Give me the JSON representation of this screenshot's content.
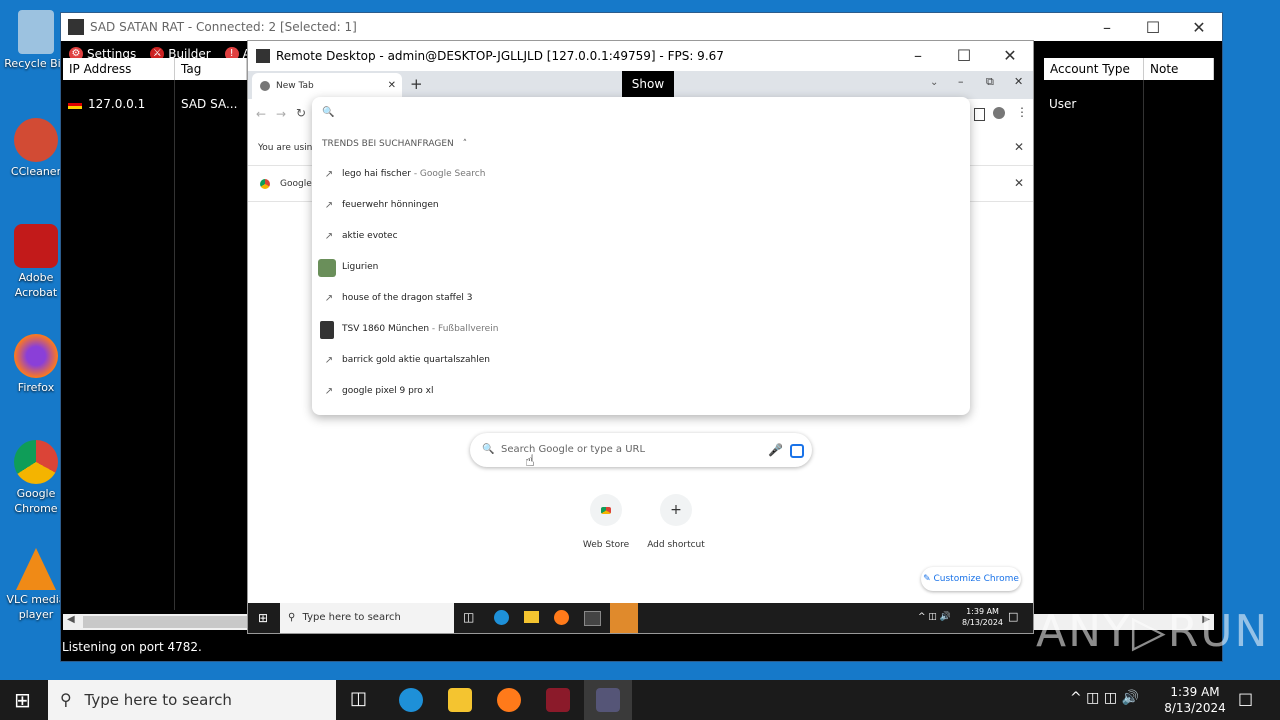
{
  "desktop": {
    "icons": [
      {
        "label": "Recycle Bin",
        "color": "#7fb0d8"
      },
      {
        "label": "CCleaner",
        "color": "#d24b34"
      },
      {
        "label": "Adobe Acrobat",
        "color": "#c21a1a"
      },
      {
        "label": "Firefox",
        "color": "#ff7a1a"
      },
      {
        "label": "Google Chrome",
        "color": "#2f8fe6"
      },
      {
        "label": "VLC media player",
        "color": "#f08a16"
      }
    ]
  },
  "rat": {
    "title": "SAD SATAN RAT - Connected: 2 [Selected: 1]",
    "menu": {
      "settings": "Settings",
      "builder": "Builder",
      "about": "A"
    },
    "columns": {
      "ip": "IP Address",
      "tag": "Tag",
      "account_type": "Account Type",
      "note": "Note"
    },
    "row": {
      "ip": "127.0.0.1",
      "tag": "SAD SA...",
      "account_type": "User"
    },
    "status": "Listening on port 4782."
  },
  "remote_desktop": {
    "title": "Remote Desktop - admin@DESKTOP-JGLLJLD [127.0.0.1:49759] - FPS: 9.67",
    "show_button": "Show",
    "chrome": {
      "tab_title": "New Tab",
      "infobar1": "You are using a",
      "infobar2": "Google C",
      "dropdown_heading": "TRENDS BEI SUCHANFRAGEN",
      "suggestions": [
        {
          "text": "lego hai fischer",
          "sub": " - Google Search",
          "icon": "trend"
        },
        {
          "text": "feuerwehr hönningen",
          "sub": "",
          "icon": "trend"
        },
        {
          "text": "aktie evotec",
          "sub": "",
          "icon": "trend"
        },
        {
          "text": "Ligurien",
          "sub": "",
          "icon": "image"
        },
        {
          "text": "house of the dragon staffel 3",
          "sub": "",
          "icon": "trend"
        },
        {
          "text": "TSV 1860 München",
          "sub": " - Fußballverein",
          "icon": "crest"
        },
        {
          "text": "barrick gold aktie quartalszahlen",
          "sub": "",
          "icon": "trend"
        },
        {
          "text": "google pixel 9 pro xl",
          "sub": "",
          "icon": "trend"
        }
      ],
      "search_placeholder": "Search Google or type a URL",
      "shortcuts": {
        "web_store": "Web Store",
        "add_shortcut": "Add shortcut"
      },
      "customize": "Customize Chrome"
    },
    "taskbar": {
      "search": "Type here to search",
      "time": "1:39 AM",
      "date": "8/13/2024"
    }
  },
  "taskbar": {
    "search_placeholder": "Type here to search",
    "time": "1:39 AM",
    "date": "8/13/2024"
  },
  "watermark": "ANY▷RUN"
}
